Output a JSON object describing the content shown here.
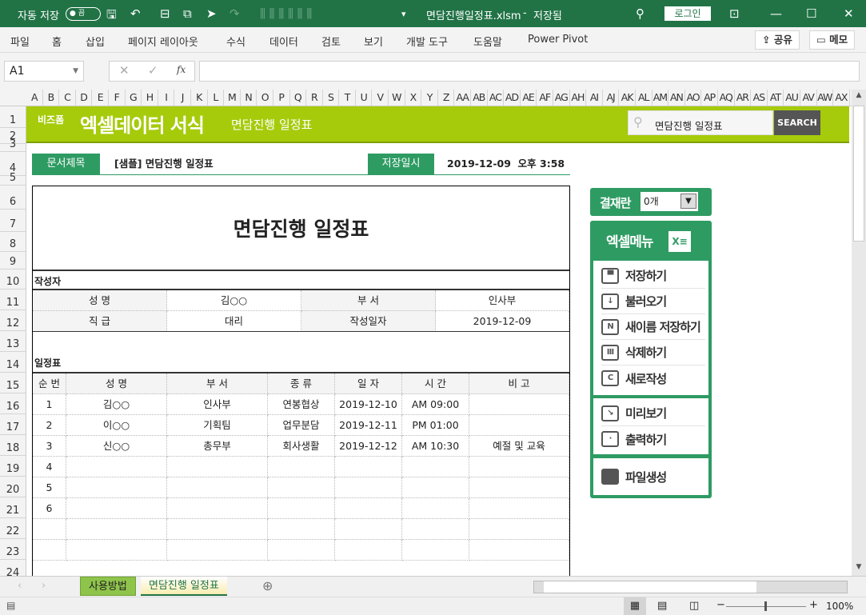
{
  "titlebar": {
    "autosave_label": "자동 저장",
    "autosave_state": "끔",
    "filename": "면담진행일정표.xlsm",
    "separator": "-",
    "save_status": "저장됨",
    "login": "로그인"
  },
  "ribbon": {
    "tabs": [
      "파일",
      "홈",
      "삽입",
      "페이지 레이아웃",
      "수식",
      "데이터",
      "검토",
      "보기",
      "개발 도구",
      "도움말",
      "Power Pivot"
    ],
    "share": "공유",
    "memo": "메모"
  },
  "formula": {
    "name_box": "A1",
    "fx": "fx",
    "value": ""
  },
  "columns": [
    "A",
    "B",
    "C",
    "D",
    "E",
    "F",
    "G",
    "H",
    "I",
    "J",
    "K",
    "L",
    "M",
    "N",
    "O",
    "P",
    "Q",
    "R",
    "S",
    "T",
    "U",
    "V",
    "W",
    "X",
    "Y",
    "Z",
    "AA",
    "AB",
    "AC",
    "AD",
    "AE",
    "AF",
    "AG",
    "AH",
    "AI",
    "AJ",
    "AK",
    "AL",
    "AM",
    "AN",
    "AO",
    "AP",
    "AQ",
    "AR",
    "AS",
    "AT",
    "AU",
    "AV",
    "AW",
    "AX"
  ],
  "rows": [
    "1",
    "2",
    "3",
    "4",
    "5",
    "6",
    "7",
    "8",
    "9",
    "10",
    "11",
    "12",
    "13",
    "14",
    "15",
    "16",
    "17",
    "18",
    "19",
    "20",
    "21",
    "22",
    "23",
    "24"
  ],
  "banner": {
    "brand_small": "비즈폼",
    "brand": "엑셀데이터 서식",
    "subtitle": "면담진행 일정표",
    "search_value": "면담진행 일정표",
    "search_button": "SEARCH"
  },
  "docinfo": {
    "title_label": "문서제목",
    "title_value": "[샘플] 면담진행 일정표",
    "saved_label": "저장일시",
    "saved_value": "2019-12-09  오후 3:58"
  },
  "doc": {
    "title": "면담진행 일정표",
    "author_section": "작성자",
    "author": [
      [
        "성  명",
        "김○○",
        "부  서",
        "인사부"
      ],
      [
        "직  급",
        "대리",
        "작성일자",
        "2019-12-09"
      ]
    ],
    "schedule_section": "일정표",
    "headers": [
      "순 번",
      "성  명",
      "부  서",
      "종  류",
      "일  자",
      "시  간",
      "비  고"
    ],
    "rows": [
      [
        "1",
        "김○○",
        "인사부",
        "연봉협상",
        "2019-12-10",
        "AM 09:00",
        ""
      ],
      [
        "2",
        "이○○",
        "기획팀",
        "업무분담",
        "2019-12-11",
        "PM 01:00",
        ""
      ],
      [
        "3",
        "신○○",
        "총무부",
        "회사생활",
        "2019-12-12",
        "AM 10:30",
        "예절 및 교육"
      ],
      [
        "4",
        "",
        "",
        "",
        "",
        "",
        ""
      ],
      [
        "5",
        "",
        "",
        "",
        "",
        "",
        ""
      ],
      [
        "6",
        "",
        "",
        "",
        "",
        "",
        ""
      ],
      [
        "",
        "",
        "",
        "",
        "",
        "",
        ""
      ],
      [
        "",
        "",
        "",
        "",
        "",
        "",
        ""
      ]
    ]
  },
  "approval": {
    "label": "결재란",
    "value": "0개"
  },
  "menu": {
    "title": "엑셀메뉴",
    "items": [
      "저장하기",
      "불러오기",
      "새이름 저장하기",
      "삭제하기",
      "새로작성",
      "미리보기",
      "출력하기",
      "파일생성"
    ]
  },
  "sheets": [
    "사용방법",
    "면담진행 일정표"
  ],
  "status": {
    "zoom": "100%"
  },
  "colors": {
    "excel_green": "#217346",
    "banner": "#a6cb0b",
    "label_green": "#2e9b63"
  }
}
